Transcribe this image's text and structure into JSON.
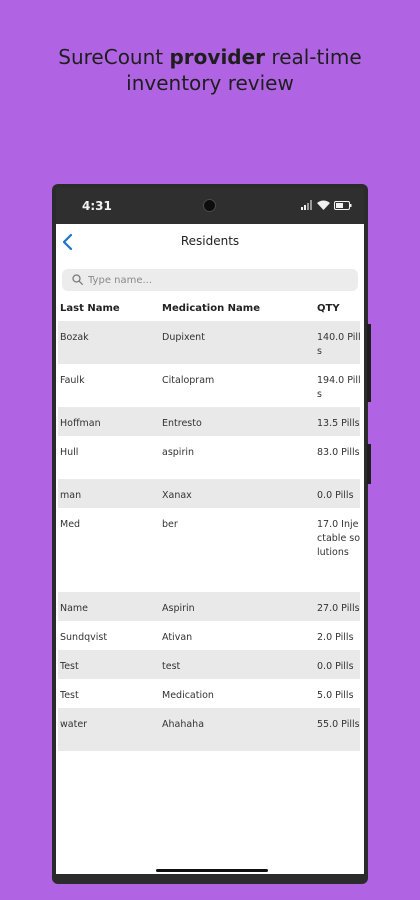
{
  "headline": {
    "line1_pre": "SureCount ",
    "line1_bold": "provider",
    "line1_post": " real-time",
    "line2": "inventory review"
  },
  "status_bar": {
    "time": "4:31",
    "icons": [
      "signal-icon",
      "wifi-icon",
      "battery-icon"
    ]
  },
  "nav": {
    "title": "Residents",
    "back_icon": "chevron-left-icon",
    "accent": "#1a73c8"
  },
  "search": {
    "placeholder": "Type name...",
    "value": ""
  },
  "table": {
    "headers": [
      "Last Name",
      "Medication Name",
      "QTY"
    ],
    "rows": [
      {
        "last_name": "Bozak",
        "medication": "Dupixent",
        "qty": "140.0 Pills"
      },
      {
        "last_name": "Faulk",
        "medication": "Citalopram",
        "qty": "194.0 Pills"
      },
      {
        "last_name": "Hoffman",
        "medication": "Entresto",
        "qty": "13.5 Pills"
      },
      {
        "last_name": "Hull",
        "medication": "aspirin",
        "qty": "83.0 Pills"
      },
      {
        "last_name": "man",
        "medication": "Xanax",
        "qty": "0.0 Pills"
      },
      {
        "last_name": "Med",
        "medication": "ber",
        "qty": "17.0 Injectable solutions"
      },
      {
        "last_name": "Name",
        "medication": "Aspirin",
        "qty": "27.0 Pills"
      },
      {
        "last_name": "Sundqvist",
        "medication": "Ativan",
        "qty": "2.0 Pills"
      },
      {
        "last_name": "Test",
        "medication": "test",
        "qty": "0.0 Pills"
      },
      {
        "last_name": "Test",
        "medication": "Medication",
        "qty": "5.0 Pills"
      },
      {
        "last_name": "water",
        "medication": "Ahahaha",
        "qty": "55.0 Pills"
      }
    ]
  },
  "colors": {
    "background": "#b064e4",
    "row_shade": "#e9e9e9"
  }
}
